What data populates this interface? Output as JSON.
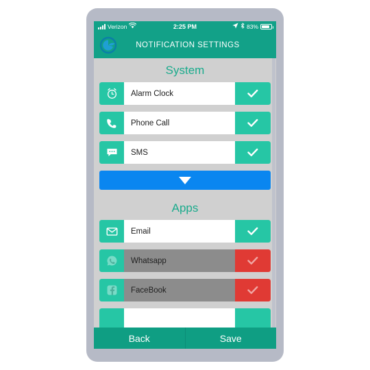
{
  "status_bar": {
    "carrier": "Verizon",
    "signal_icon": "signal-bars-icon",
    "wifi_icon": "wifi-icon",
    "time": "2:25 PM",
    "location_icon": "location-arrow-icon",
    "bluetooth_icon": "bluetooth-icon",
    "battery_percent": "83%",
    "battery_icon": "battery-icon"
  },
  "app_bar": {
    "logo_icon": "app-logo-icon",
    "title": "NOTIFICATION SETTINGS"
  },
  "sections": [
    {
      "title": "System",
      "rows": [
        {
          "icon": "alarm-clock-icon",
          "label": "Alarm Clock",
          "enabled": true
        },
        {
          "icon": "phone-icon",
          "label": "Phone Call",
          "enabled": true
        },
        {
          "icon": "sms-icon",
          "label": "SMS",
          "enabled": true
        }
      ]
    },
    {
      "title": "Apps",
      "rows": [
        {
          "icon": "email-icon",
          "label": "Email",
          "enabled": true
        },
        {
          "icon": "whatsapp-icon",
          "label": "Whatsapp",
          "enabled": false
        },
        {
          "icon": "facebook-icon",
          "label": "FaceBook",
          "enabled": false
        },
        {
          "icon": "app-icon",
          "label": "",
          "enabled": true
        }
      ]
    }
  ],
  "expand_button": {
    "icon": "chevron-down-icon",
    "label": ""
  },
  "footer": {
    "back_label": "Back",
    "save_label": "Save"
  },
  "colors": {
    "header_teal": "#12a188",
    "accent_teal": "#26c6a5",
    "heading_green": "#1aab8c",
    "expand_blue": "#0a86f0",
    "disabled_gray": "#8c8c8c",
    "off_red": "#e03a34",
    "screen_bg": "#d0d0d0",
    "frame_gray": "#b6bac6",
    "footer_teal": "#0f9e83"
  }
}
